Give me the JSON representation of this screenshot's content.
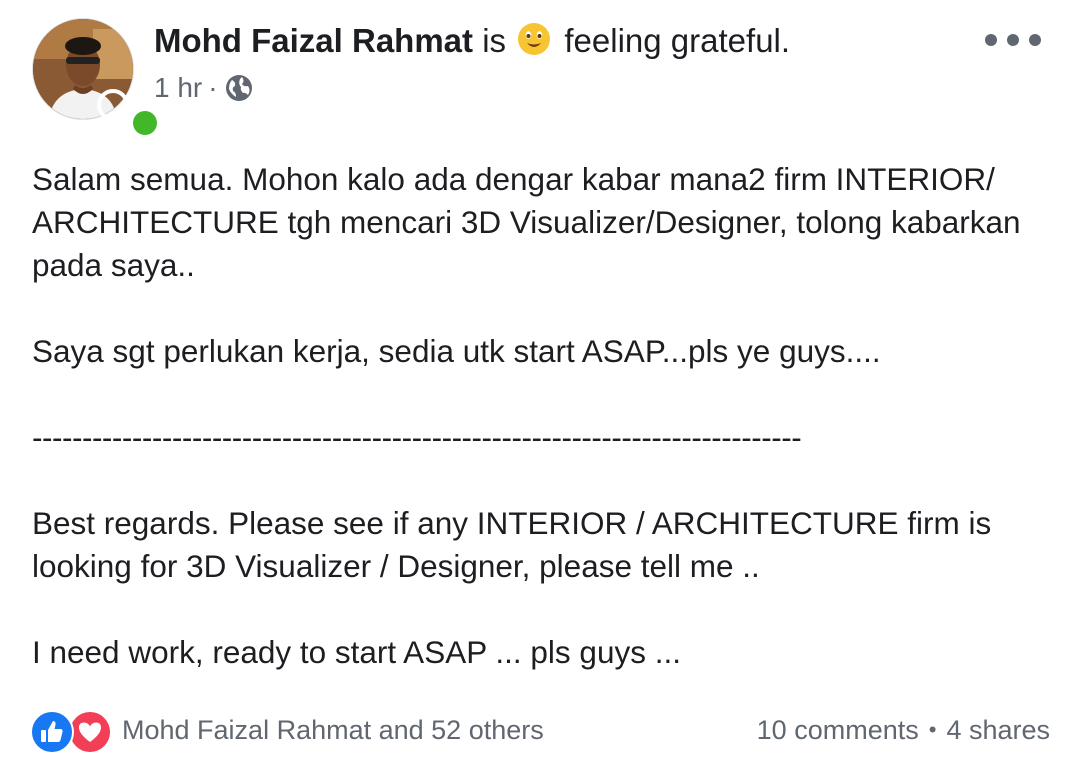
{
  "post": {
    "author": "Mohd Faizal Rahmat",
    "activity_prefix": "is",
    "feeling": "feeling grateful.",
    "feeling_icon": "grateful-face-emoji-icon",
    "time": "1 hr",
    "meta_separator": "·",
    "privacy_icon": "globe-icon",
    "online_status_color": "#42b72a",
    "more_icon": "more-options-icon",
    "body": {
      "p1": "Salam semua. Mohon kalo ada dengar kabar mana2 firm INTERIOR/ ARCHITECTURE tgh mencari 3D Visualizer/Designer, tolong kabarkan pada saya..",
      "p2": "Saya sgt perlukan kerja, sedia utk start ASAP...pls ye guys....",
      "divider": "-----------------------------------------------------------------------------",
      "p3": "Best regards. Please see if any INTERIOR / ARCHITECTURE firm is looking for 3D Visualizer / Designer, please tell me ..",
      "p4": "I need work, ready to start ASAP ... pls guys ..."
    },
    "reactions": {
      "icons": [
        "like-icon",
        "love-icon"
      ],
      "like_color": "#1877f2",
      "love_color": "#f33e58",
      "summary": "Mohd Faizal Rahmat and 52 others"
    },
    "stats": {
      "comments": "10 comments",
      "separator": "•",
      "shares": "4 shares"
    }
  }
}
